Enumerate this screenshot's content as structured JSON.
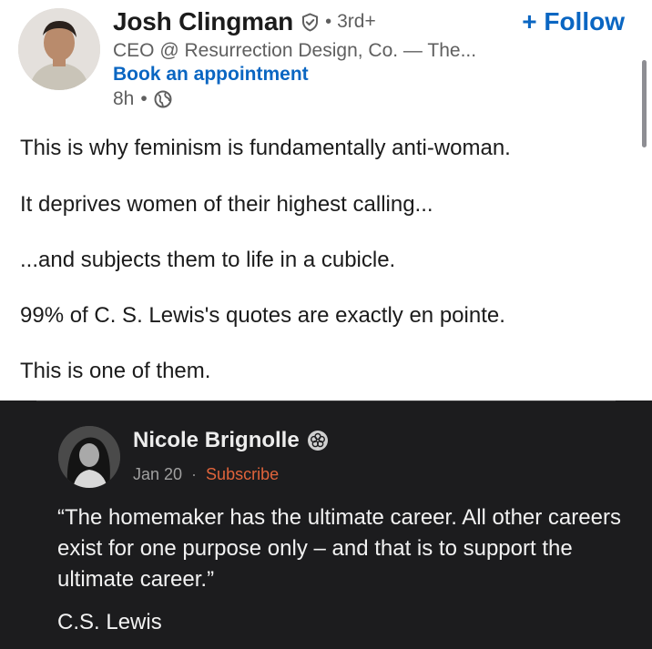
{
  "author": {
    "name": "Josh Clingman",
    "degree": "3rd+",
    "headline": "CEO @ Resurrection Design, Co. — The...",
    "cta": "Book an appointment",
    "time": "8h"
  },
  "actions": {
    "follow_label": "+ Follow"
  },
  "post": {
    "paragraphs": [
      "This is why feminism is fundamentally anti-woman.",
      "It deprives women of their highest calling...",
      "...and subjects them to life in a cubicle.",
      "99% of C. S. Lewis's quotes are exactly en pointe.",
      "This is one of them."
    ]
  },
  "embed": {
    "author": "Nicole Brignolle",
    "date": "Jan 20",
    "subscribe": "Subscribe",
    "quote": "“The homemaker has the ultimate career. All other careers exist for one purpose only – and that is to support the ultimate career.”",
    "attribution": "C.S. Lewis"
  },
  "colors": {
    "link_blue": "#0a66c2",
    "embed_background": "#1c1c1e",
    "subscribe_orange": "#e0643b"
  },
  "icons": {
    "verified": "verified-shield-icon",
    "visibility": "globe-icon",
    "badge": "flower-badge-icon"
  }
}
